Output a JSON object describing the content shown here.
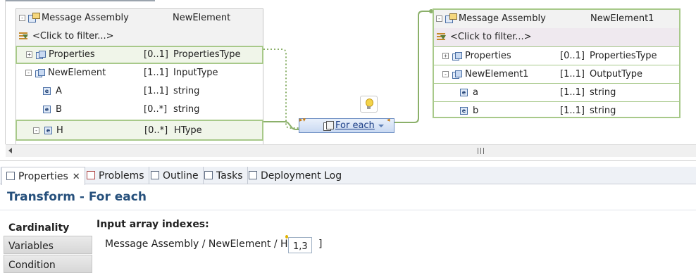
{
  "source": {
    "title": "Message Assembly",
    "title_value": "NewElement",
    "filter": "<Click to filter...>",
    "rows": [
      {
        "name": "Properties",
        "card": "[0..1]",
        "type": "PropertiesType",
        "twisty": "+"
      },
      {
        "name": "NewElement",
        "card": "[1..1]",
        "type": "InputType",
        "twisty": "-"
      },
      {
        "name": "A",
        "card": "[1..1]",
        "type": "string"
      },
      {
        "name": "B",
        "card": "[0..*]",
        "type": "string"
      },
      {
        "name": "H",
        "card": "[0..*]",
        "type": "HType",
        "twisty": "-"
      }
    ]
  },
  "target": {
    "title": "Message Assembly",
    "title_value": "NewElement1",
    "filter": "<Click to filter...>",
    "rows": [
      {
        "name": "Properties",
        "card": "[0..1]",
        "type": "PropertiesType",
        "twisty": "+"
      },
      {
        "name": "NewElement1",
        "card": "[1..1]",
        "type": "OutputType",
        "twisty": "-"
      },
      {
        "name": "a",
        "card": "[1..1]",
        "type": "string"
      },
      {
        "name": "b",
        "card": "[1..1]",
        "type": "string"
      }
    ]
  },
  "transform": {
    "label": "For each"
  },
  "tabs": [
    {
      "label": "Properties",
      "close": "✕"
    },
    {
      "label": "Problems"
    },
    {
      "label": "Outline"
    },
    {
      "label": "Tasks"
    },
    {
      "label": "Deployment Log"
    }
  ],
  "properties": {
    "title": "Transform - For each",
    "side_tabs": [
      "Cardinality",
      "Variables",
      "Condition"
    ],
    "section_label": "Input array indexes:",
    "path": "Message Assembly / NewElement / H [",
    "index_value": "1,3",
    "close_bracket": "]"
  },
  "colors": {
    "connection": "#8bb06a",
    "title_text": "#26507c",
    "node_text": "#1d3f87"
  },
  "icons": {
    "element": "element-icon",
    "properties": "properties-icon",
    "message_assembly": "message-assembly-icon",
    "filter": "filter-icon",
    "lightbulb": "lightbulb-icon"
  }
}
